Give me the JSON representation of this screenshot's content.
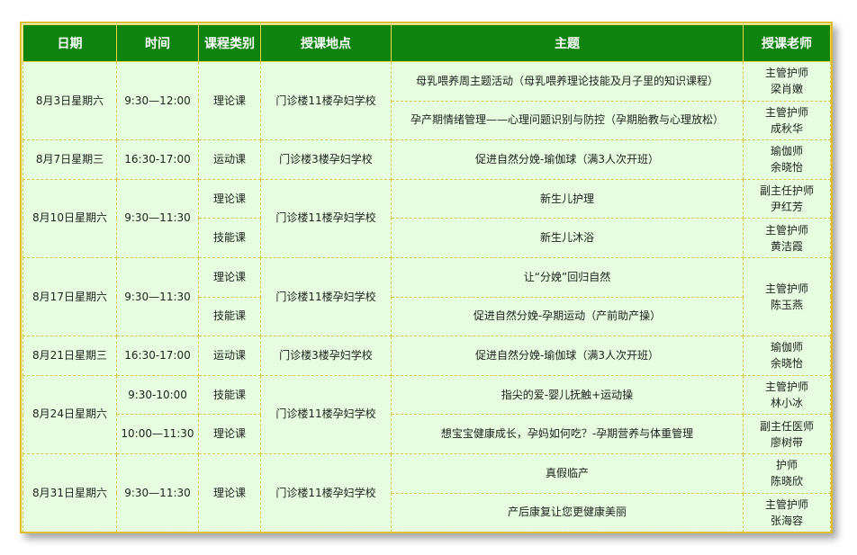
{
  "headers": [
    "日期",
    "时间",
    "课程类别",
    "授课地点",
    "主题",
    "授课老师"
  ],
  "groups": [
    {
      "date": "8月3日星期六",
      "time": "9:30—12:00",
      "category": "理论课",
      "location": "门诊楼11楼孕妇学校",
      "topics": [
        "母乳喂养周主题活动（母乳喂养理论技能及月子里的知识课程）",
        "孕产期情绪管理——心理问题识别与防控（孕期胎教与心理放松）"
      ],
      "teachers": [
        {
          "title": "主管护师",
          "name": "梁肖嫩"
        },
        {
          "title": "主管护师",
          "name": "成秋华"
        }
      ]
    },
    {
      "date": "8月7日星期三",
      "time": "16:30-17:00",
      "category": "运动课",
      "location": "门诊楼3楼孕妇学校",
      "topic": "促进自然分娩-瑜伽球（满3人次开班）",
      "teacher": {
        "title": "瑜伽师",
        "name": "余晓怡"
      }
    },
    {
      "date": "8月10日星期六",
      "time": "9:30—11:30",
      "location": "门诊楼11楼孕妇学校",
      "categories": [
        "理论课",
        "技能课"
      ],
      "topics": [
        "新生儿护理",
        "新生儿沐浴"
      ],
      "teachers": [
        {
          "title": "副主任护师",
          "name": "尹红芳"
        },
        {
          "title": "主管护师",
          "name": "黄洁霞"
        }
      ]
    },
    {
      "date": "8月17日星期六",
      "time": "9:30—11:30",
      "location": "门诊楼11楼孕妇学校",
      "categories": [
        "理论课",
        "技能课"
      ],
      "topics": [
        "让“分娩”回归自然",
        "促进自然分娩-孕期运动（产前助产操）"
      ],
      "teacher": {
        "title": "主管护师",
        "name": "陈玉燕"
      }
    },
    {
      "date": "8月21日星期三",
      "time": "16:30-17:00",
      "category": "运动课",
      "location": "门诊楼3楼孕妇学校",
      "topic": "促进自然分娩-瑜伽球（满3人次开班）",
      "teacher": {
        "title": "瑜伽师",
        "name": "余晓怡"
      }
    },
    {
      "date": "8月24日星期六",
      "location": "门诊楼11楼孕妇学校",
      "times": [
        "9:30-10:00",
        "10:00—11:30"
      ],
      "categories": [
        "技能课",
        "理论课"
      ],
      "topics": [
        "指尖的爱-婴儿抚触+运动操",
        "想宝宝健康成长，孕妈如何吃？-孕期营养与体重管理"
      ],
      "teachers": [
        {
          "title": "主管护师",
          "name": "林小冰"
        },
        {
          "title": "副主任医师",
          "name": "廖树带"
        }
      ]
    },
    {
      "date": "8月31日星期六",
      "time": "9:30—11:30",
      "category": "理论课",
      "location": "门诊楼11楼孕妇学校",
      "topics": [
        "真假临产",
        "产后康复让您更健康美丽"
      ],
      "teachers": [
        {
          "title": "护师",
          "name": "陈晓欣"
        },
        {
          "title": "主管护师",
          "name": "张海容"
        }
      ]
    }
  ]
}
